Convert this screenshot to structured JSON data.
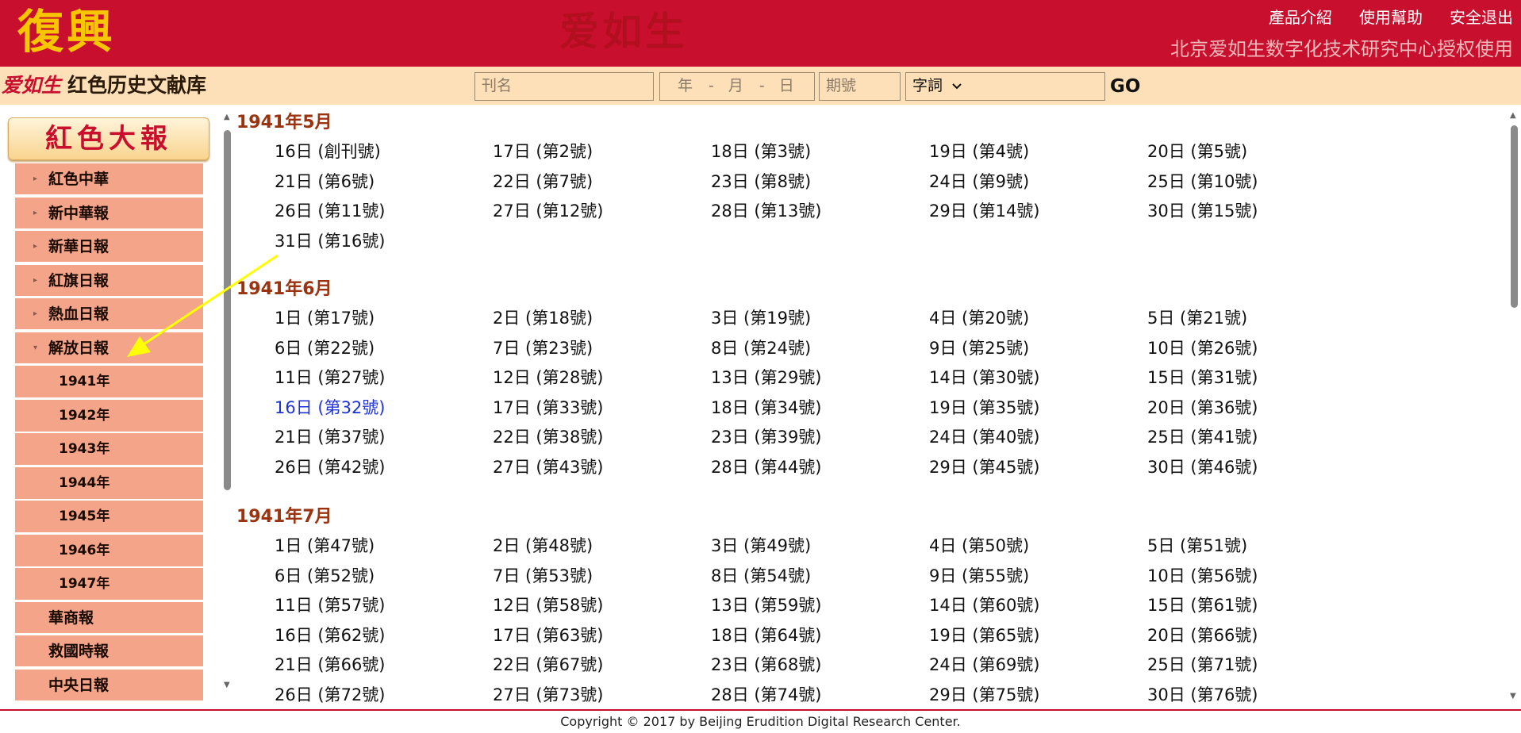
{
  "header": {
    "logo": "復興",
    "center_logo": "爱如生",
    "links": [
      "產品介紹",
      "使用幫助",
      "安全退出"
    ],
    "authorization": "北京爱如生数字化技术研究中心授权使用"
  },
  "search": {
    "brand_red": "爱如生",
    "brand_dark": "红色历史文献库",
    "journal_placeholder": "刊名",
    "date_year": "年",
    "date_sep": "-",
    "date_month": "月",
    "date_day": "日",
    "issue_placeholder": "期號",
    "type_label": "字詞",
    "type_icon": "chevron-down-icon",
    "go_label": "GO"
  },
  "sidebar": {
    "title": "紅色大報",
    "items": [
      {
        "label": "紅色中華",
        "expanded": false
      },
      {
        "label": "新中華報",
        "expanded": false
      },
      {
        "label": "新華日報",
        "expanded": false
      },
      {
        "label": "紅旗日報",
        "expanded": false
      },
      {
        "label": "熱血日報",
        "expanded": false
      },
      {
        "label": "解放日報",
        "expanded": true
      }
    ],
    "years": [
      "1941年",
      "1942年",
      "1943年",
      "1944年",
      "1945年",
      "1946年",
      "1947年"
    ],
    "after_items": [
      "華商報",
      "救國時報",
      "中央日報"
    ]
  },
  "main": {
    "months": [
      {
        "title": "1941年5月",
        "issues": [
          "16日 (創刊號)",
          "17日 (第2號)",
          "18日 (第3號)",
          "19日 (第4號)",
          "20日 (第5號)",
          "21日 (第6號)",
          "22日 (第7號)",
          "23日 (第8號)",
          "24日 (第9號)",
          "25日 (第10號)",
          "26日 (第11號)",
          "27日 (第12號)",
          "28日 (第13號)",
          "29日 (第14號)",
          "30日 (第15號)",
          "31日 (第16號)"
        ]
      },
      {
        "title": "1941年6月",
        "issues": [
          "1日 (第17號)",
          "2日 (第18號)",
          "3日 (第19號)",
          "4日 (第20號)",
          "5日 (第21號)",
          "6日 (第22號)",
          "7日 (第23號)",
          "8日 (第24號)",
          "9日 (第25號)",
          "10日 (第26號)",
          "11日 (第27號)",
          "12日 (第28號)",
          "13日 (第29號)",
          "14日 (第30號)",
          "15日 (第31號)",
          "16日 (第32號)",
          "17日 (第33號)",
          "18日 (第34號)",
          "19日 (第35號)",
          "20日 (第36號)",
          "21日 (第37號)",
          "22日 (第38號)",
          "23日 (第39號)",
          "24日 (第40號)",
          "25日 (第41號)",
          "26日 (第42號)",
          "27日 (第43號)",
          "28日 (第44號)",
          "29日 (第45號)",
          "30日 (第46號)"
        ]
      },
      {
        "title": "1941年7月",
        "issues": [
          "1日 (第47號)",
          "2日 (第48號)",
          "3日 (第49號)",
          "4日 (第50號)",
          "5日 (第51號)",
          "6日 (第52號)",
          "7日 (第53號)",
          "8日 (第54號)",
          "9日 (第55號)",
          "10日 (第56號)",
          "11日 (第57號)",
          "12日 (第58號)",
          "13日 (第59號)",
          "14日 (第60號)",
          "15日 (第61號)",
          "16日 (第62號)",
          "17日 (第63號)",
          "18日 (第64號)",
          "19日 (第65號)",
          "20日 (第66號)",
          "21日 (第66號)",
          "22日 (第67號)",
          "23日 (第68號)",
          "24日 (第69號)",
          "25日 (第71號)",
          "26日 (第72號)",
          "27日 (第73號)",
          "28日 (第74號)",
          "29日 (第75號)",
          "30日 (第76號)"
        ]
      }
    ],
    "active_issue": "16日 (第32號)"
  },
  "footer": {
    "copyright": "Copyright © 2017 by Beijing Erudition Digital Research Center."
  },
  "colors": {
    "header_red": "#c8102e",
    "logo_gold": "#f7c600",
    "search_bg": "#fde0b8",
    "sidebar_item": "#f3a489",
    "month_title": "#9a3410",
    "active_link": "#1f32d6",
    "annotation": "#ffff00"
  }
}
